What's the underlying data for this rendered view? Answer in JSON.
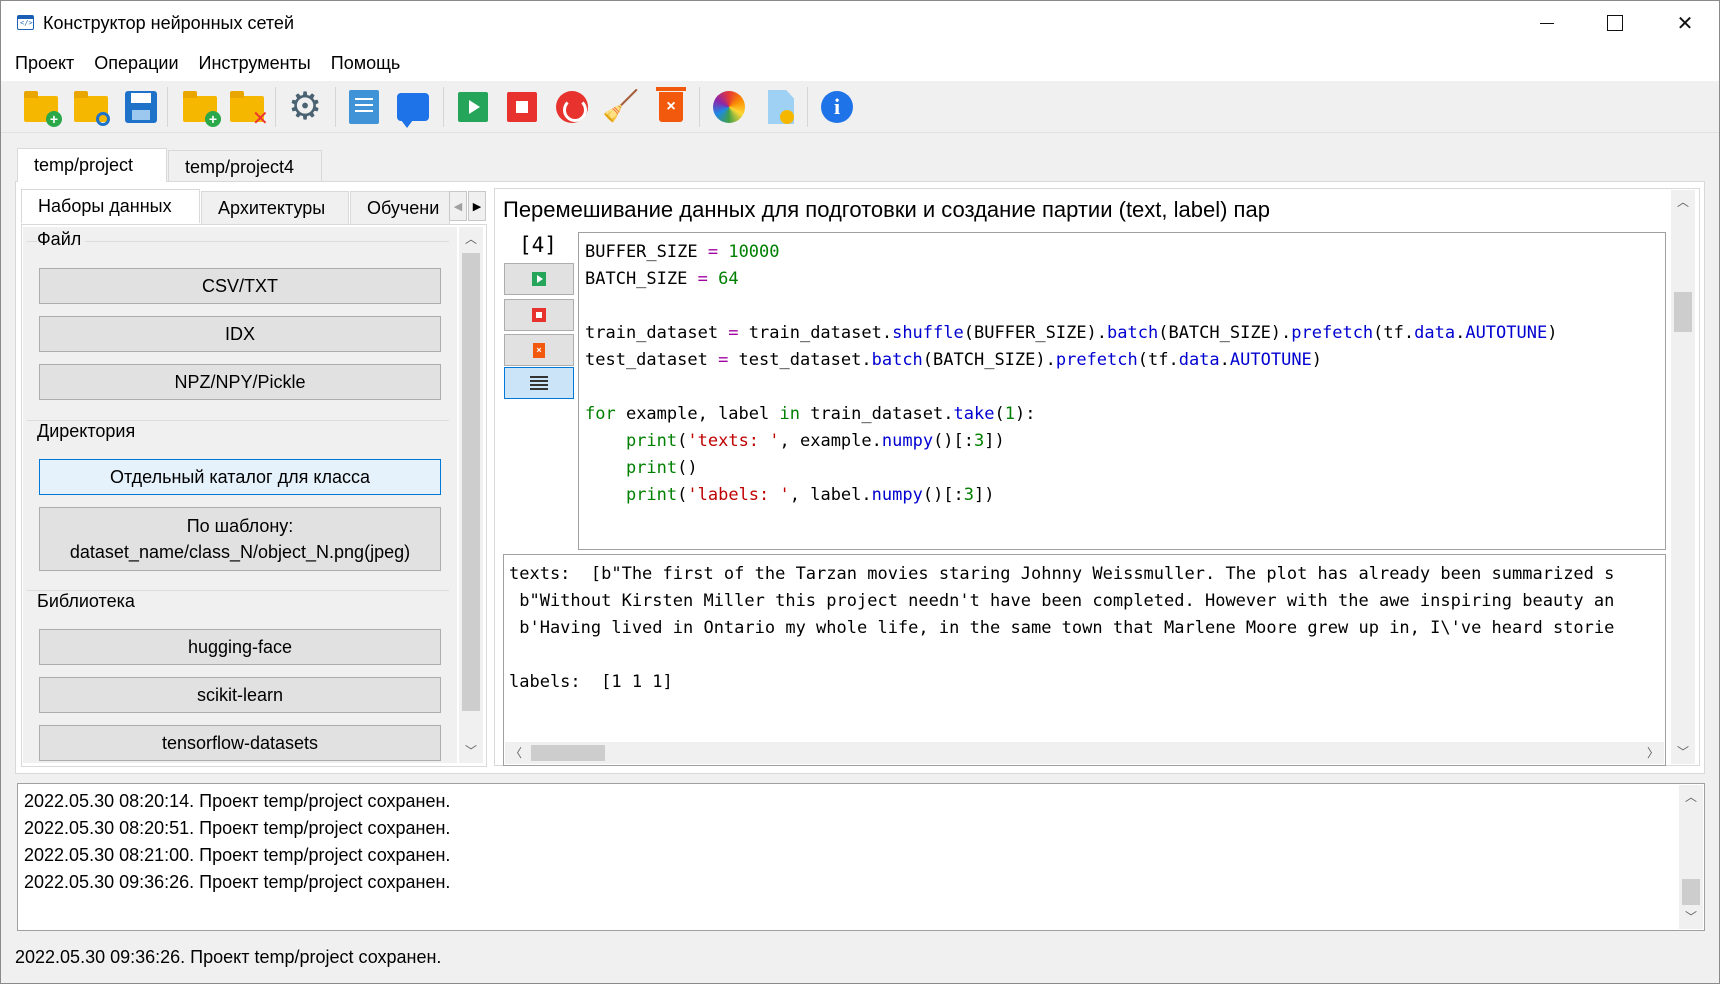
{
  "window": {
    "title": "Конструктор нейронных сетей",
    "icon": "code-window-icon"
  },
  "menu": [
    "Проект",
    "Операции",
    "Инструменты",
    "Помощь"
  ],
  "toolbar": [
    "new-project-icon",
    "open-project-icon",
    "save-icon",
    "add-folder-icon",
    "remove-folder-icon",
    "settings-gear-icon",
    "document-icon",
    "chat-icon",
    "run-icon",
    "stop-icon",
    "restart-icon",
    "clear-icon",
    "delete-icon",
    "palette-icon",
    "file-settings-icon",
    "info-icon"
  ],
  "project_tabs": [
    "temp/project",
    "temp/project4"
  ],
  "left_tabs": [
    "Наборы данных",
    "Архитектуры",
    "Обучени"
  ],
  "datasets": {
    "file_group": "Файл",
    "file_buttons": [
      "CSV/TXT",
      "IDX",
      "NPZ/NPY/Pickle"
    ],
    "dir_group": "Директория",
    "dir_button_1": "Отдельный каталог для класса",
    "dir_button_2_line1": "По шаблону:",
    "dir_button_2_line2": "dataset_name/class_N/object_N.png(jpeg)",
    "lib_group": "Библиотека",
    "lib_buttons": [
      "hugging-face",
      "scikit-learn",
      "tensorflow-datasets"
    ]
  },
  "cell": {
    "title": "Перемешивание данных для подготовки и создание партии (text, label) пар",
    "number": "[4]",
    "code_lines": [
      "BUFFER_SIZE = 10000",
      "BATCH_SIZE = 64",
      "",
      "train_dataset = train_dataset.shuffle(BUFFER_SIZE).batch(BATCH_SIZE).prefetch(tf.data.AUTOTUNE)",
      "test_dataset = test_dataset.batch(BATCH_SIZE).prefetch(tf.data.AUTOTUNE)",
      "",
      "for example, label in train_dataset.take(1):",
      "    print('texts: ', example.numpy()[:3])",
      "    print()",
      "    print('labels: ', label.numpy()[:3])"
    ],
    "output_lines": [
      "texts:  [b\"The first of the Tarzan movies staring Johnny Weissmuller. The plot has already been summarized s",
      " b\"Without Kirsten Miller this project needn't have been completed. However with the awe inspiring beauty an",
      " b'Having lived in Ontario my whole life, in the same town that Marlene Moore grew up in, I\\'ve heard storie",
      "",
      "labels:  [1 1 1]"
    ]
  },
  "log": [
    "2022.05.30 08:20:14. Проект temp/project сохранен.",
    "2022.05.30 08:20:51. Проект temp/project сохранен.",
    "2022.05.30 08:21:00. Проект temp/project сохранен.",
    "2022.05.30 09:36:26. Проект temp/project сохранен."
  ],
  "status": "2022.05.30 09:36:26. Проект temp/project сохранен."
}
